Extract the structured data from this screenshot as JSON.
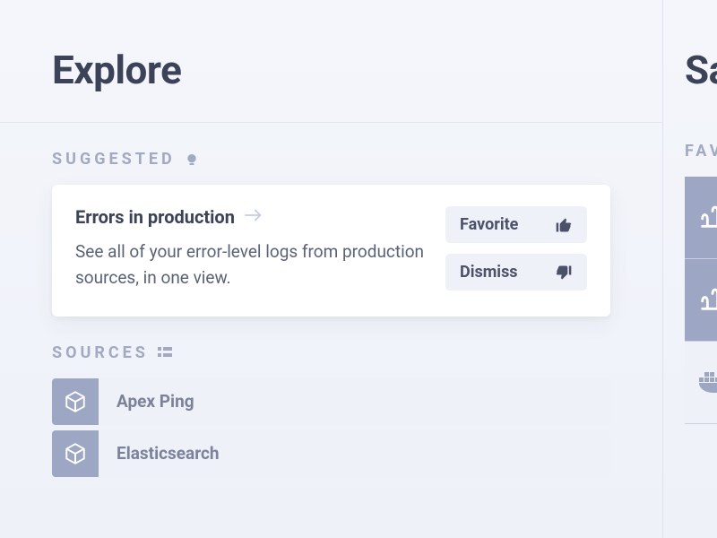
{
  "left": {
    "title": "Explore",
    "suggested": {
      "label": "Suggested",
      "card": {
        "title": "Errors in production",
        "desc": "See all of your error-level logs from production sources, in one view.",
        "favorite": "Favorite",
        "dismiss": "Dismiss"
      }
    },
    "sources": {
      "label": "Sources",
      "items": [
        {
          "name": "Apex Ping"
        },
        {
          "name": "Elasticsearch"
        }
      ]
    }
  },
  "right": {
    "title": "Sa",
    "favorites_label": "FAV"
  }
}
